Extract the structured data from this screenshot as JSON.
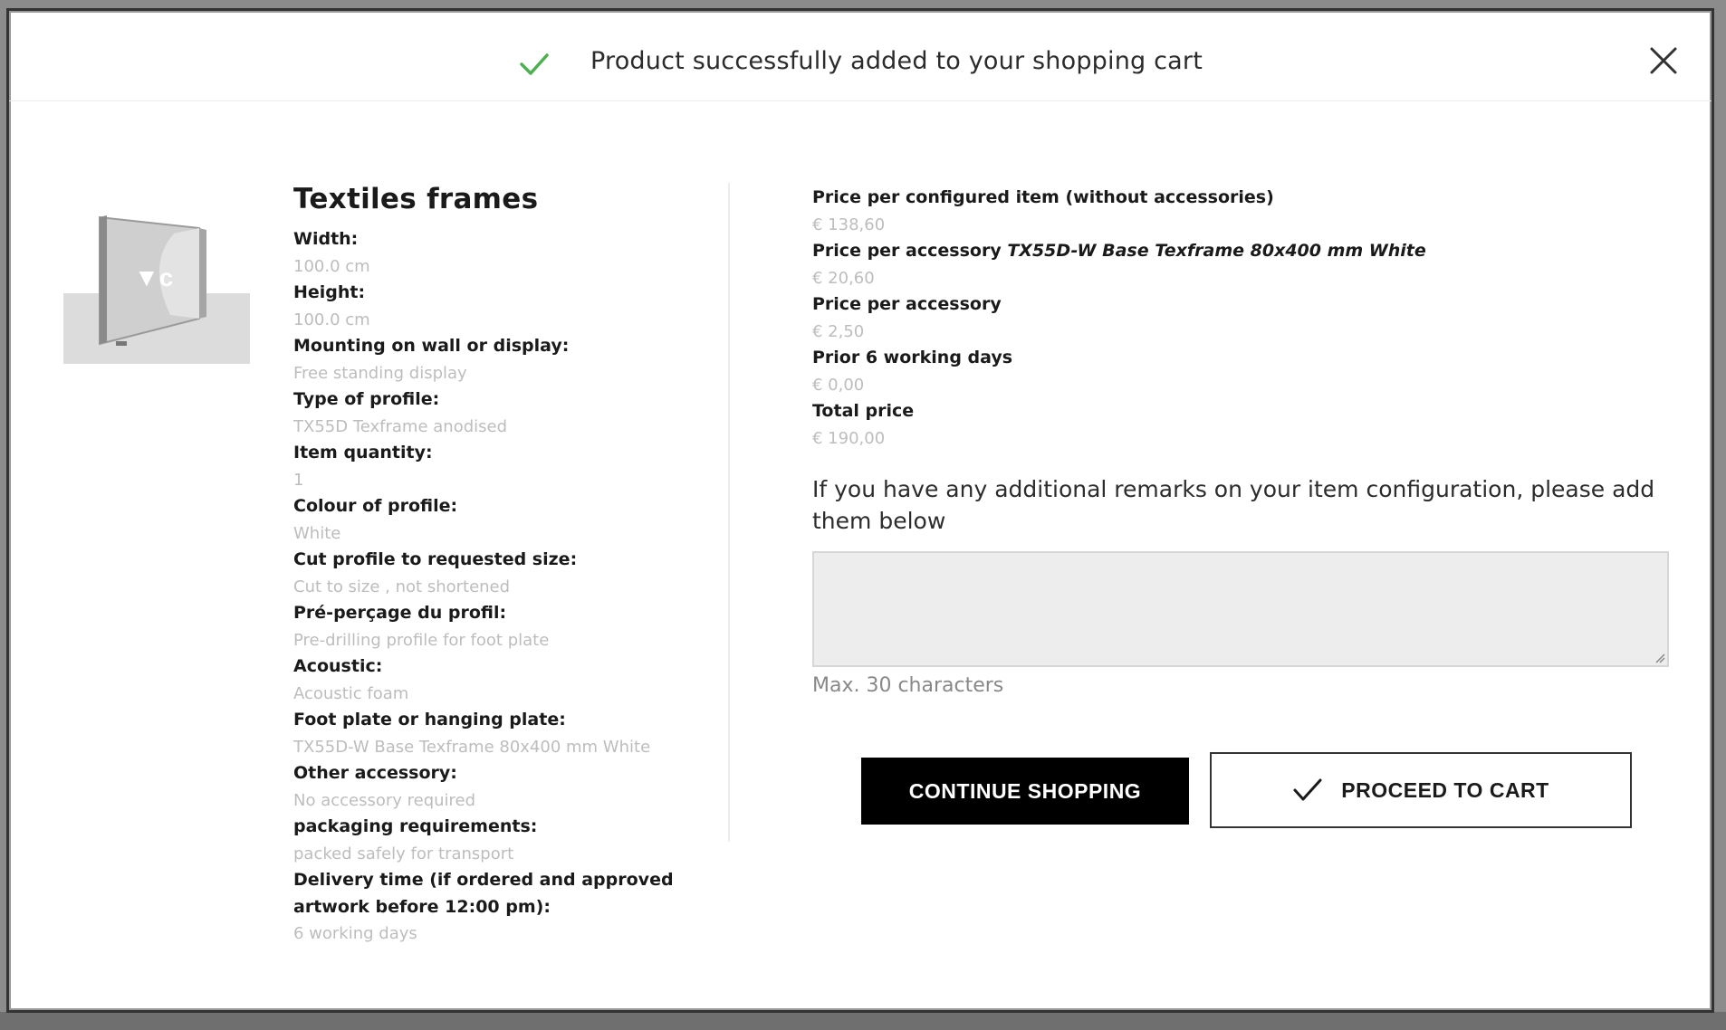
{
  "header": {
    "message": "Product successfully added to your shopping cart"
  },
  "product": {
    "title": "Textiles frames",
    "specs": [
      {
        "label": "Width:",
        "value": "100.0 cm"
      },
      {
        "label": "Height:",
        "value": "100.0 cm"
      },
      {
        "label": "Mounting on wall or display:",
        "value": "Free standing display"
      },
      {
        "label": "Type of profile:",
        "value": "TX55D Texframe anodised"
      },
      {
        "label": "Item quantity:",
        "value": "1"
      },
      {
        "label": "Colour of profile:",
        "value": "White"
      },
      {
        "label": "Cut profile to requested size:",
        "value": "Cut to size , not shortened"
      },
      {
        "label": "Pré-perçage du profil:",
        "value": "Pre-drilling profile for foot plate"
      },
      {
        "label": "Acoustic:",
        "value": "Acoustic foam"
      },
      {
        "label": "Foot plate or hanging plate:",
        "value": "TX55D-W Base Texframe 80x400 mm White"
      },
      {
        "label": "Other accessory:",
        "value": "No accessory required"
      },
      {
        "label": "packaging requirements:",
        "value": "packed safely for transport"
      },
      {
        "label": "Delivery time (if ordered and approved artwork before 12:00 pm):",
        "value": "6 working days"
      }
    ]
  },
  "prices": {
    "configured_label": "Price per configured item (without accessories)",
    "configured_value": "€ 138,60",
    "accessory1_label_prefix": "Price per accessory ",
    "accessory1_label_name": "TX55D-W Base Texframe 80x400 mm White",
    "accessory1_value": "€ 20,60",
    "accessory2_label": "Price per accessory",
    "accessory2_value": "€ 2,50",
    "prior_label": "Prior 6 working days",
    "prior_value": "€ 0,00",
    "total_label": "Total price",
    "total_value": "€ 190,00"
  },
  "remarks": {
    "prompt": "If you have any additional remarks on your item configuration, please add them below",
    "value": "",
    "hint": "Max. 30 characters"
  },
  "actions": {
    "continue_label": "CONTINUE SHOPPING",
    "proceed_label": "PROCEED TO CART"
  },
  "icons": {
    "header_check": "check-icon",
    "close": "close-icon",
    "proceed_check": "check-icon"
  },
  "colors": {
    "success_green": "#4caf50",
    "value_grey": "#bdbdbd",
    "button_black": "#000000"
  }
}
